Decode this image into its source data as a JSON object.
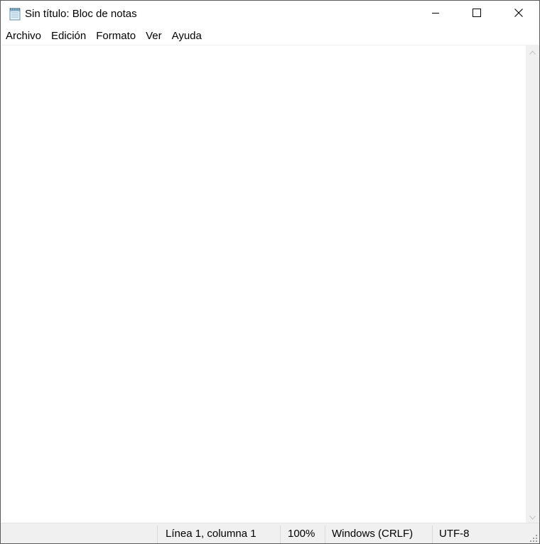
{
  "window": {
    "title": "Sin título: Bloc de notas",
    "app_icon": "notepad-icon",
    "controls": {
      "minimize_icon": "minimize-icon",
      "maximize_icon": "maximize-icon",
      "close_icon": "close-icon"
    }
  },
  "menu": {
    "items": [
      {
        "label": "Archivo"
      },
      {
        "label": "Edición"
      },
      {
        "label": "Formato"
      },
      {
        "label": "Ver"
      },
      {
        "label": "Ayuda"
      }
    ]
  },
  "editor": {
    "content": ""
  },
  "status": {
    "position": "Línea 1, columna 1",
    "zoom": "100%",
    "line_ending": "Windows (CRLF)",
    "encoding": "UTF-8"
  },
  "colors": {
    "window_bg": "#ffffff",
    "statusbar_bg": "#f0f0f0",
    "scrollbar_bg": "#f0f0f0",
    "border": "#5b5b5b"
  }
}
